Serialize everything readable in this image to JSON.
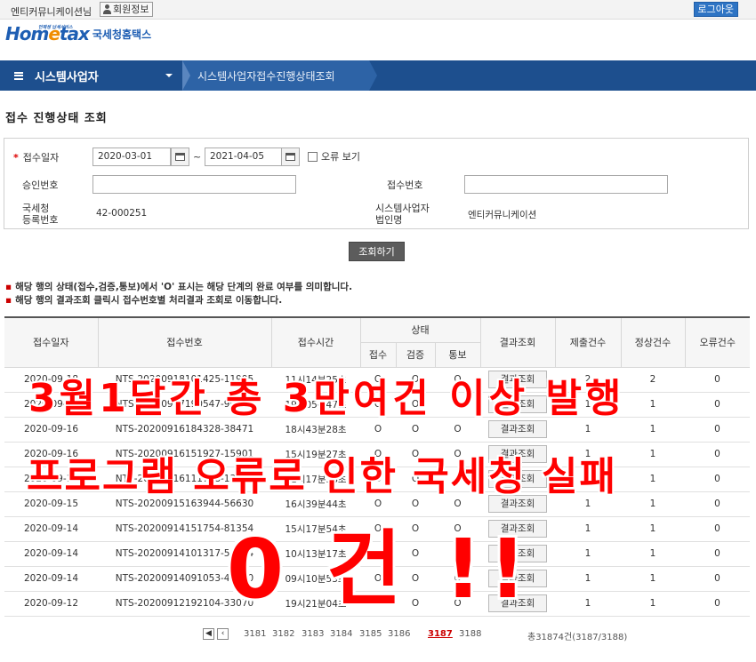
{
  "topbar": {
    "user_name": "엔티커뮤니케이션님",
    "member_info": "회원정보",
    "logout": "로그아웃"
  },
  "logo": {
    "word_a": "Hom",
    "word_e": "e",
    "word_b": "tax",
    "tagline": "언제생 납세서비스",
    "korean": "국세청홈택스"
  },
  "nav": {
    "menu_title": "시스템사업자",
    "breadcrumb": "시스템사업자접수진행상태조회"
  },
  "page_title": "접수 진행상태 조회",
  "search": {
    "receipt_date_label": "접수일자",
    "date_from": "2020-03-01",
    "date_to": "2021-04-05",
    "tilde": "~",
    "error_view_label": "오류 보기",
    "approval_no_label": "승인번호",
    "approval_no_value": "",
    "receipt_no_label": "접수번호",
    "receipt_no_value": "",
    "nts_reg_label_1": "국세청",
    "nts_reg_label_2": "등록번호",
    "nts_reg_value": "42-000251",
    "corp_name_label_1": "시스템사업자",
    "corp_name_label_2": "법인명",
    "corp_name_value": "엔티커뮤니케이션",
    "search_button": "조회하기"
  },
  "notices": [
    "해당 행의 상태(접수,검증,통보)에서 'O' 표시는 해당 단계의 완료 여부를 의미합니다.",
    "해당 행의 결과조회 클릭시 접수번호별 처리결과 조회로 이동합니다."
  ],
  "table": {
    "headers": {
      "date": "접수일자",
      "receipt_no": "접수번호",
      "time": "접수시간",
      "status": "상태",
      "received": "접수",
      "verified": "검증",
      "notified": "통보",
      "result": "결과조회",
      "submitted": "제출건수",
      "normal": "정상건수",
      "error": "오류건수"
    },
    "result_button": "결과조회",
    "rows": [
      {
        "date": "2020-09-18",
        "no": "NTS-20200918101425-11995",
        "time": "11시14분25초",
        "r": "O",
        "v": "O",
        "n": "O",
        "sub": "2",
        "ok": "2",
        "err": "0"
      },
      {
        "date": "2020-09-17",
        "no": "NTS-20200917190547-90200",
        "time": "19시05분47초",
        "r": "O",
        "v": "O",
        "n": "O",
        "sub": "1",
        "ok": "1",
        "err": "0"
      },
      {
        "date": "2020-09-16",
        "no": "NTS-20200916184328-38471",
        "time": "18시43분28초",
        "r": "O",
        "v": "O",
        "n": "O",
        "sub": "1",
        "ok": "1",
        "err": "0"
      },
      {
        "date": "2020-09-16",
        "no": "NTS-20200916151927-15901",
        "time": "15시19분27초",
        "r": "O",
        "v": "O",
        "n": "O",
        "sub": "1",
        "ok": "1",
        "err": "0"
      },
      {
        "date": "2020-09-16",
        "no": "NTS-20200916111738-13040",
        "time": "11시17분38초",
        "r": "O",
        "v": "O",
        "n": "O",
        "sub": "1",
        "ok": "1",
        "err": "0"
      },
      {
        "date": "2020-09-15",
        "no": "NTS-20200915163944-56630",
        "time": "16시39분44초",
        "r": "O",
        "v": "O",
        "n": "O",
        "sub": "1",
        "ok": "1",
        "err": "0"
      },
      {
        "date": "2020-09-14",
        "no": "NTS-20200914151754-81354",
        "time": "15시17분54초",
        "r": "O",
        "v": "O",
        "n": "O",
        "sub": "1",
        "ok": "1",
        "err": "0"
      },
      {
        "date": "2020-09-14",
        "no": "NTS-20200914101317-51844",
        "time": "10시13분17초",
        "r": "O",
        "v": "O",
        "n": "O",
        "sub": "1",
        "ok": "1",
        "err": "0"
      },
      {
        "date": "2020-09-14",
        "no": "NTS-20200914091053-47550",
        "time": "09시10분53초",
        "r": "O",
        "v": "O",
        "n": "O",
        "sub": "1",
        "ok": "1",
        "err": "0"
      },
      {
        "date": "2020-09-12",
        "no": "NTS-20200912192104-33070",
        "time": "19시21분04초",
        "r": "O",
        "v": "O",
        "n": "O",
        "sub": "1",
        "ok": "1",
        "err": "0"
      }
    ]
  },
  "pagination": {
    "first": "◀",
    "prev": "‹",
    "pages": [
      "3181",
      "3182",
      "3183",
      "3184",
      "3185",
      "3186",
      "3187",
      "3188"
    ],
    "current": "3187",
    "total": "총31874건(3187/3188)"
  },
  "overlay": {
    "line1": "3월1달간 총 3만여건 이상 발행",
    "line2": "프로그램 오류로 인한 국세청 실패",
    "line3": "0 건 !!"
  },
  "colors": {
    "nav_bg": "#1d4f8e",
    "logout_bg": "#2e74c4",
    "overlay_red": "#ff0000",
    "logo_blue": "#1e5eb3",
    "logo_orange": "#f08c00"
  }
}
